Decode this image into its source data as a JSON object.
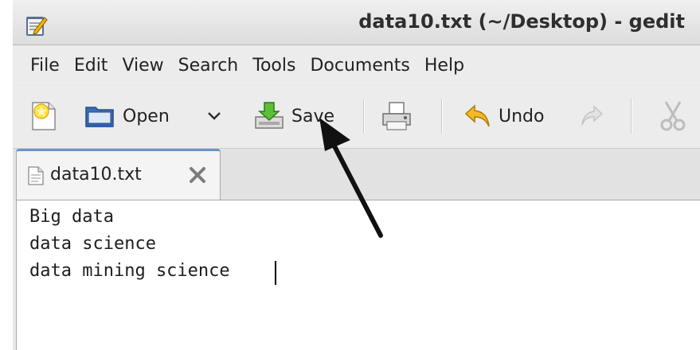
{
  "window": {
    "title": "data10.txt (~/Desktop) - gedit",
    "app_icon": "gedit-pencil-icon"
  },
  "menubar": {
    "items": [
      {
        "label": "File"
      },
      {
        "label": "Edit"
      },
      {
        "label": "View"
      },
      {
        "label": "Search"
      },
      {
        "label": "Tools"
      },
      {
        "label": "Documents"
      },
      {
        "label": "Help"
      }
    ]
  },
  "toolbar": {
    "new_icon": "new-document-icon",
    "open_label": "Open",
    "open_icon": "folder-open-icon",
    "open_dropdown_icon": "chevron-down-icon",
    "save_label": "Save",
    "save_icon": "save-icon",
    "print_icon": "printer-icon",
    "undo_label": "Undo",
    "undo_icon": "undo-icon",
    "redo_icon": "redo-icon",
    "cut_icon": "scissors-icon"
  },
  "tabs": [
    {
      "label": "data10.txt",
      "icon": "text-document-icon",
      "close_icon": "close-icon",
      "active": true
    }
  ],
  "editor": {
    "lines": [
      "Big data",
      "data science",
      "data mining science"
    ]
  },
  "annotation": {
    "arrow_icon": "pointer-arrow-icon",
    "target": "save-button"
  },
  "colors": {
    "tab_accent": "#6b93c7",
    "arrow": "#111111"
  }
}
